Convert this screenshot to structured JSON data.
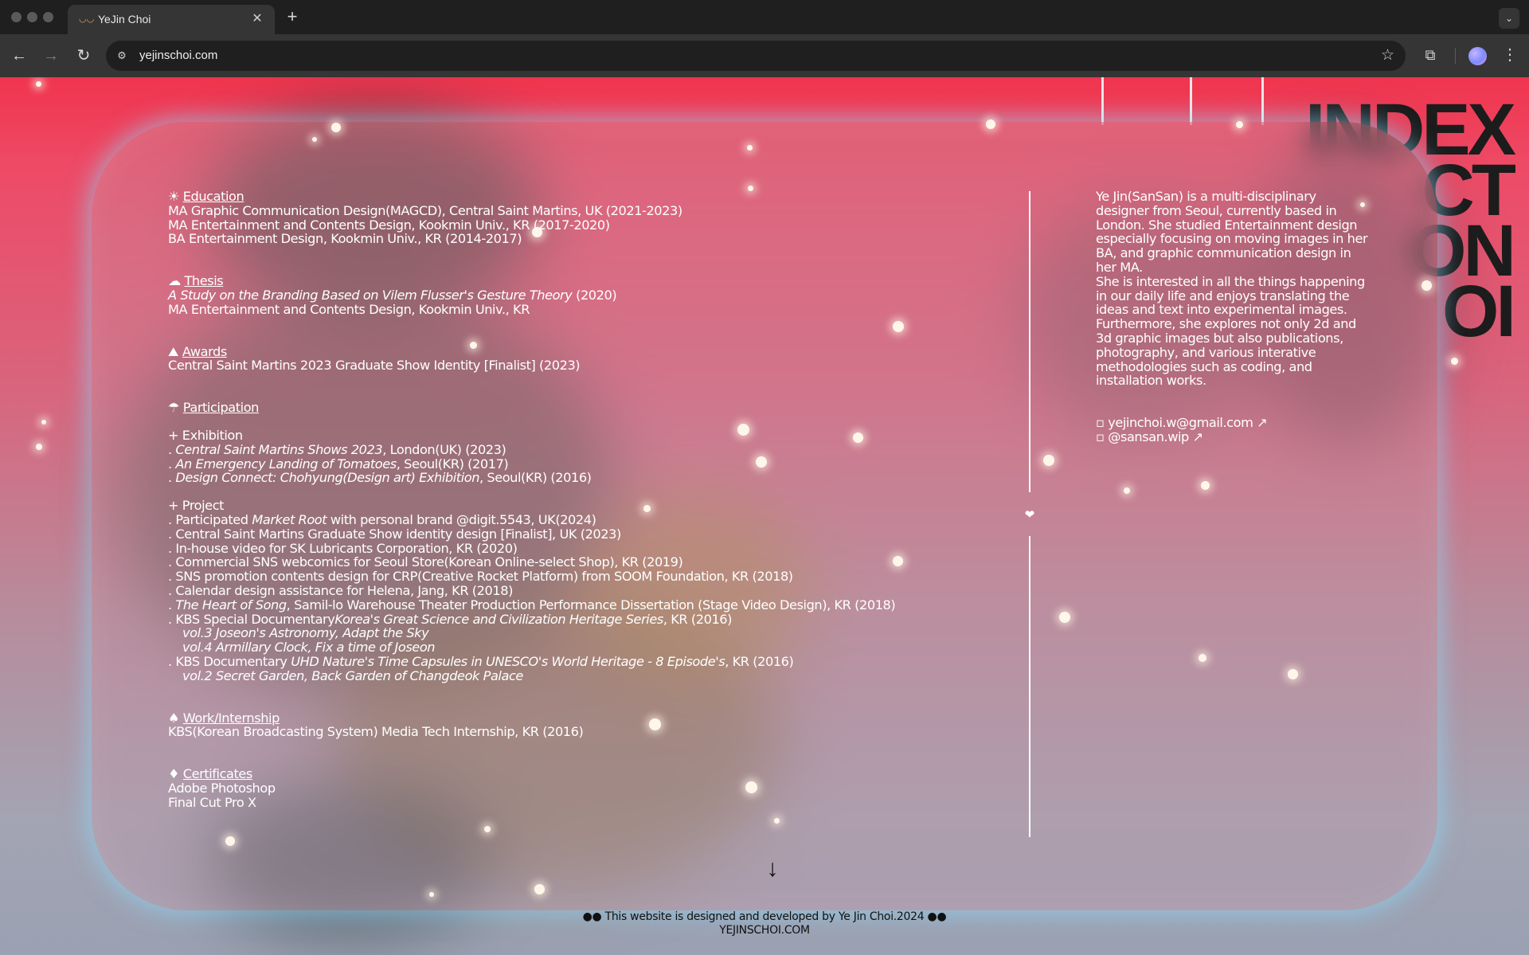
{
  "browser": {
    "tab_title": "YeJin Choi",
    "tab_favicon": "glasses-icon",
    "url": "yejinschoi.com"
  },
  "background": {
    "title_lines": [
      "INDEX",
      "CT",
      "ON",
      "OI"
    ]
  },
  "education": {
    "icon": "☀",
    "title": "Education",
    "lines": [
      "MA Graphic Communication Design(MAGCD), Central Saint Martins, UK (2021-2023)",
      "MA Entertainment and Contents Design, Kookmin Univ., KR (2017-2020)",
      "BA Entertainment Design, Kookmin Univ., KR (2014-2017)"
    ]
  },
  "thesis": {
    "icon": "☁",
    "title": "Thesis",
    "line1_italic": "A Study on the Branding Based on Vilem Flusser's Gesture Theory",
    "line1_rest": " (2020)",
    "line2": "MA Entertainment and Contents Design, Kookmin Univ., KR"
  },
  "awards": {
    "icon": "⛰",
    "title": "Awards",
    "lines": [
      "Central Saint Martins 2023 Graduate Show Identity [Finalist] (2023)"
    ]
  },
  "participation": {
    "icon": "☂",
    "title": "Participation",
    "exhibition_heading": "+ Exhibition",
    "exhibitions": [
      {
        "prefix": ". ",
        "italic": "Central Saint Martins Shows 2023",
        "rest": ", London(UK) (2023)"
      },
      {
        "prefix": ". ",
        "italic": "An Emergency Landing of Tomatoes",
        "rest": ", Seoul(KR) (2017)"
      },
      {
        "prefix": ". ",
        "italic": "Design Connect: Chohyung(Design art) Exhibition",
        "rest": ", Seoul(KR) (2016)"
      }
    ],
    "project_heading": "+ Project",
    "projects": {
      "p1_pre": ". Participated ",
      "p1_italic": "Market Root",
      "p1_rest": " with personal brand @digit.5543, UK(2024)",
      "p2": ". Central Saint Martins Graduate Show identity design [Finalist], UK (2023)",
      "p3": ". In-house video for SK Lubricants Corporation, KR (2020)",
      "p4": ". Commercial SNS webcomics for Seoul Store(Korean Online-select Shop), KR (2019)",
      "p5": ". SNS promotion contents design for CRP(Creative Rocket Platform) from SOOM Foundation, KR (2018)",
      "p6": ". Calendar design assistance for Helena, Jang, KR (2018)",
      "p7_pre": ". ",
      "p7_italic": "The Heart of Song",
      "p7_rest": ", Samil-lo Warehouse Theater Production Performance Dissertation (Stage Video Design), KR (2018)",
      "p8_pre": ". KBS Special Documentary",
      "p8_italic": "Korea's Great Science and Civilization Heritage Series",
      "p8_rest": ", KR (2016)",
      "p8_sub1": "vol.3 Joseon's Astronomy, Adapt the Sky",
      "p8_sub2": "vol.4 Armillary Clock, Fix a time of Joseon",
      "p9_pre": ". KBS Documentary ",
      "p9_italic": "UHD Nature's Time Capsules in UNESCO's World Heritage - 8 Episode's",
      "p9_rest": ", KR (2016)",
      "p9_sub1": "vol.2 Secret Garden, Back Garden of Changdeok Palace"
    }
  },
  "work": {
    "icon": "♠",
    "title": "Work/Internship",
    "lines": [
      "KBS(Korean Broadcasting System) Media Tech Internship, KR (2016)"
    ]
  },
  "certificates": {
    "icon": "♦",
    "title": "Certificates",
    "lines": [
      "Adobe Photoshop",
      "Final Cut Pro X"
    ]
  },
  "about": {
    "bio1": "Ye Jin(SanSan) is a multi-disciplinary designer from Seoul, currently based in London. She studied Entertainment design especially focusing on moving images in her BA, and graphic communication design in her MA.",
    "bio2": "She is interested in all the things happening in our daily life and enjoys translating the ideas and text into experimental images. Furthermore, she explores not only 2d and 3d graphic images but also publications, photography, and various interative methodologies such as coding, and installation works.",
    "email_bullet": "▫",
    "email": "yejinchoi.w@gmail.com",
    "email_arrow": "↗",
    "insta_bullet": "▫",
    "insta": "@sansan.wip",
    "insta_arrow": "↗"
  },
  "divider_heart": "❤",
  "scroll_arrow": "↓",
  "footer": {
    "line1_left": "●●",
    "line1": "This website is designed and developed by Ye Jin Choi.2024",
    "line1_right": "●●",
    "line2": "YEJINSCHOI.COM"
  },
  "colors": {
    "page_top": "#f0344e",
    "page_bottom": "#9aa1b2",
    "glass_glow": "#8cdcff",
    "text": "#ffffff"
  }
}
